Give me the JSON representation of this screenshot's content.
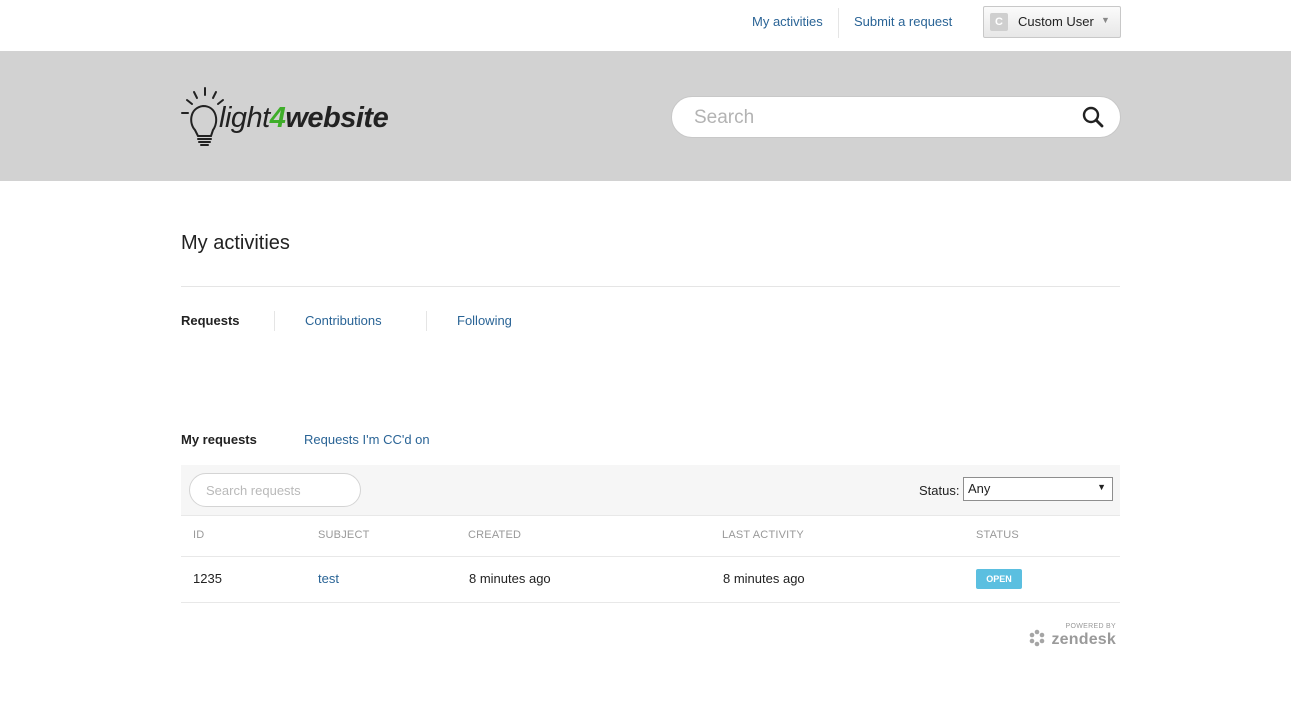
{
  "topnav": {
    "my_activities": "My activities",
    "submit_request": "Submit a request",
    "user_name": "Custom User",
    "avatar_letter": "C"
  },
  "logo": {
    "part1": "light",
    "part2": "4",
    "part3": "website"
  },
  "search": {
    "placeholder": "Search"
  },
  "page": {
    "title": "My activities"
  },
  "tabs": [
    {
      "label": "Requests"
    },
    {
      "label": "Contributions"
    },
    {
      "label": "Following"
    }
  ],
  "subtabs": [
    {
      "label": "My requests"
    },
    {
      "label": "Requests I'm CC'd on"
    }
  ],
  "filter": {
    "search_placeholder": "Search requests",
    "status_label": "Status:",
    "status_value": "Any"
  },
  "table": {
    "headers": [
      "ID",
      "SUBJECT",
      "CREATED",
      "LAST ACTIVITY",
      "STATUS"
    ],
    "rows": [
      {
        "id": "1235",
        "subject": "test",
        "created": "8 minutes ago",
        "last_activity": "8 minutes ago",
        "status": "OPEN"
      }
    ]
  },
  "footer": {
    "powered_by": "POWERED BY",
    "brand": "zendesk"
  },
  "colors": {
    "link": "#2a6496",
    "hero_bg": "#d2d2d2",
    "status_open": "#5bbfe0",
    "logo_green": "#3fae2a"
  }
}
